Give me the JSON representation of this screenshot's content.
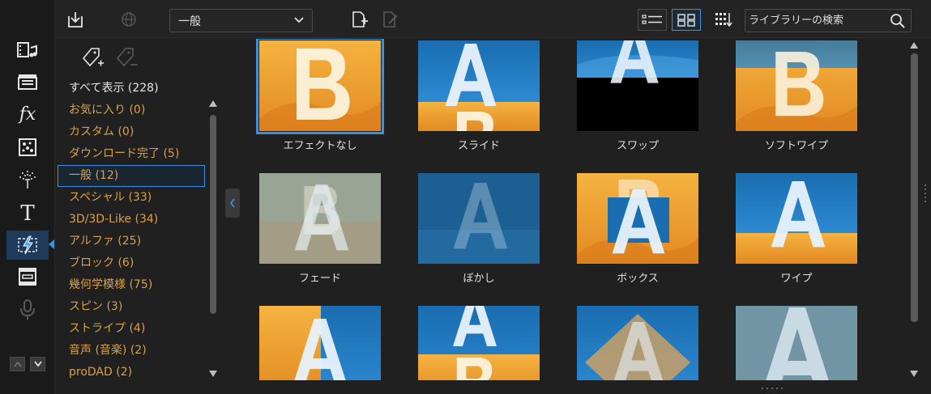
{
  "toolbar": {
    "import_icon": "import-icon",
    "download_icon": "globe-download-icon",
    "category_value": "一般",
    "add_icon": "add-file-icon",
    "edit_icon": "edit-file-icon",
    "list_view_icon": "list-view-icon",
    "grid_view_icon": "grid-view-icon",
    "sort_icon": "sort-icon",
    "search_placeholder": "ライブラリーの検索"
  },
  "rail": [
    {
      "name": "media-room-icon",
      "active": false
    },
    {
      "name": "clapper-icon",
      "active": false
    },
    {
      "name": "fx-icon",
      "active": false
    },
    {
      "name": "particle-icon",
      "active": false
    },
    {
      "name": "firework-icon",
      "active": false
    },
    {
      "name": "title-icon",
      "active": false
    },
    {
      "name": "transition-icon",
      "active": true
    },
    {
      "name": "subtitle-icon",
      "active": false
    },
    {
      "name": "microphone-icon",
      "active": false
    }
  ],
  "categories": [
    "すべて表示 (228)",
    "お気に入り (0)",
    "カスタム (0)",
    "ダウンロード完了 (5)",
    "一般 (12)",
    "スペシャル (33)",
    "3D/3D-Like (34)",
    "アルファ (25)",
    "ブロック (6)",
    "幾何学模様 (75)",
    "スピン (3)",
    "ストライプ (4)",
    "音声 (音楽) (2)",
    "proDAD (2)"
  ],
  "selected_category_index": 4,
  "transitions": [
    {
      "label": "エフェクトなし",
      "style": "none"
    },
    {
      "label": "スライド",
      "style": "slide"
    },
    {
      "label": "スワップ",
      "style": "swap"
    },
    {
      "label": "ソフトワイプ",
      "style": "softwipe"
    },
    {
      "label": "フェード",
      "style": "fade"
    },
    {
      "label": "ぼかし",
      "style": "blur"
    },
    {
      "label": "ボックス",
      "style": "box"
    },
    {
      "label": "ワイプ",
      "style": "wipe"
    },
    {
      "label": "",
      "style": "r3a"
    },
    {
      "label": "",
      "style": "r3b"
    },
    {
      "label": "",
      "style": "r3c"
    },
    {
      "label": "",
      "style": "r3d"
    }
  ],
  "selected_transition_index": 0,
  "colors": {
    "accent": "#3f8fe0",
    "category_text": "#d9a04a",
    "thumb_orange": "#f0a030",
    "thumb_blue": "#1a6db0"
  }
}
